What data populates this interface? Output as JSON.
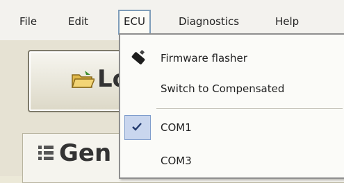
{
  "menubar": {
    "items": [
      "File",
      "Edit",
      "ECU",
      "Diagnostics",
      "Help"
    ]
  },
  "main": {
    "load_button_label": "Lo",
    "general_label": "Gen"
  },
  "dropdown": {
    "items": [
      {
        "label": "Firmware flasher",
        "icon": "chip-icon"
      },
      {
        "label": "Switch to Compensated"
      },
      {
        "label": "COM1",
        "checked": true
      },
      {
        "label": "COM3"
      }
    ]
  },
  "colors": {
    "highlight": "#c9d6ee",
    "menu_border": "#7f9db9"
  }
}
